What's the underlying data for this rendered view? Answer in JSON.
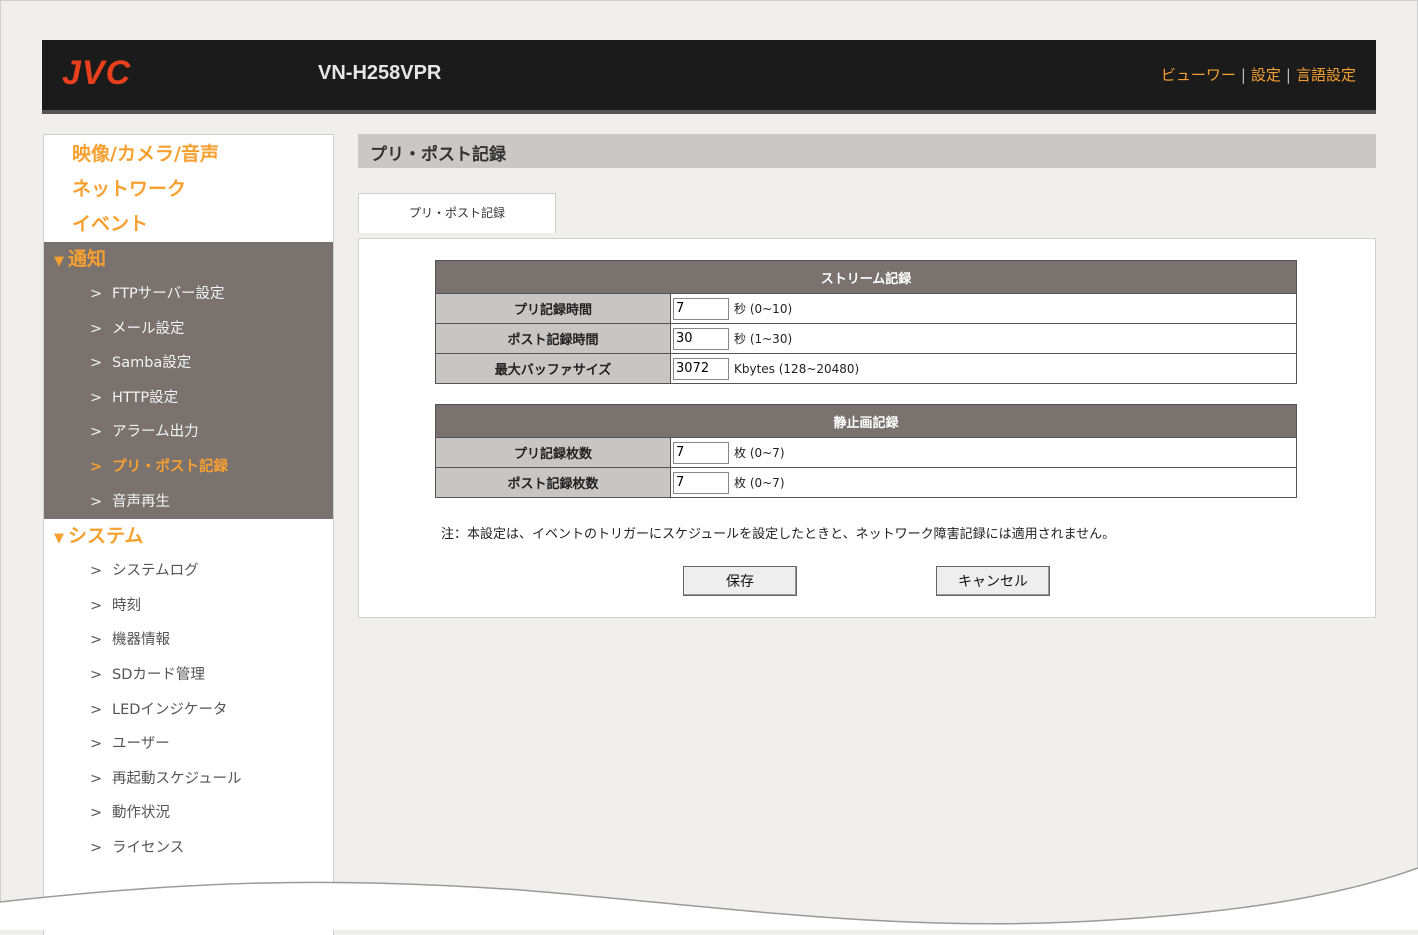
{
  "header": {
    "logo": "JVC",
    "model": "VN-H258VPR",
    "links": [
      "ビューワー",
      "設定",
      "言語設定"
    ],
    "separator": "|"
  },
  "sidebar": {
    "sections_top": [
      "映像/カメラ/音声",
      "ネットワーク",
      "イベント"
    ],
    "notify": {
      "label": "通知",
      "items": [
        "FTPサーバー設定",
        "メール設定",
        "Samba設定",
        "HTTP設定",
        "アラーム出力",
        "プリ・ポスト記録",
        "音声再生"
      ],
      "active_item": "プリ・ポスト記録"
    },
    "system": {
      "label": "システム",
      "items": [
        "システムログ",
        "時刻",
        "機器情報",
        "SDカード管理",
        "LEDインジケータ",
        "ユーザー",
        "再起動スケジュール",
        "動作状況",
        "ライセンス"
      ]
    },
    "arrow": ">",
    "triangle": "▼"
  },
  "main": {
    "page_title": "プリ・ポスト記録",
    "tab_label": "プリ・ポスト記録",
    "stream": {
      "heading": "ストリーム記録",
      "rows": [
        {
          "label": "プリ記録時間",
          "value": "7",
          "unit": "秒 (0~10)"
        },
        {
          "label": "ポスト記録時間",
          "value": "30",
          "unit": "秒 (1~30)"
        },
        {
          "label": "最大バッファサイズ",
          "value": "3072",
          "unit": "Kbytes (128~20480)"
        }
      ]
    },
    "still": {
      "heading": "静止画記録",
      "rows": [
        {
          "label": "プリ記録枚数",
          "value": "7",
          "unit": "枚 (0~7)"
        },
        {
          "label": "ポスト記録枚数",
          "value": "7",
          "unit": "枚 (0~7)"
        }
      ]
    },
    "note": "注：本設定は、イベントのトリガーにスケジュールを設定したときと、ネットワーク障害記録には適用されません。",
    "save_label": "保存",
    "cancel_label": "キャンセル"
  },
  "colors": {
    "brand": "#e8401c",
    "accent": "#f7a030",
    "header_bg": "#1b1b1b",
    "sidebar_group_bg": "#79726f"
  }
}
